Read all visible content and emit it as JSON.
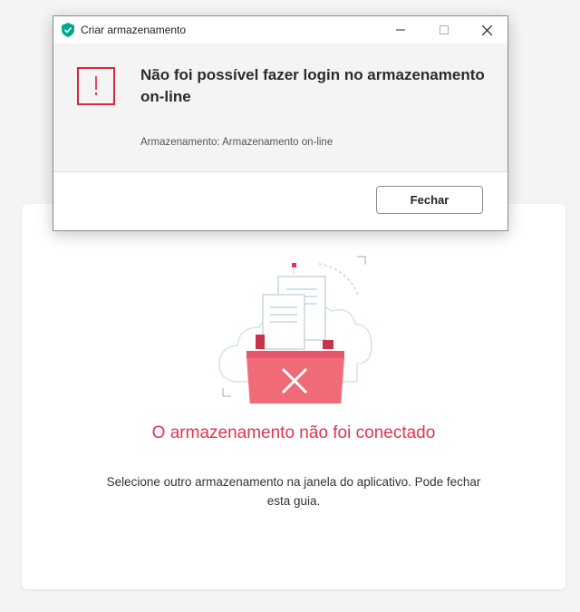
{
  "dialog": {
    "title": "Criar armazenamento",
    "headline": "Não foi possível fazer login no armazenamento on-line",
    "storage_info": "Armazenamento: Armazenamento on-line",
    "close_button": "Fechar",
    "error_glyph": "!",
    "icons": [
      "shield-check-icon",
      "minimize-icon",
      "maximize-icon",
      "close-icon",
      "error-icon"
    ]
  },
  "card": {
    "title": "O armazenamento não foi conectado",
    "message": "Selecione outro armazenamento na janela do aplicativo. Pode fechar esta guia.",
    "illustration": "folder-error-icon"
  },
  "colors": {
    "accent_red": "#e2334f",
    "error_border": "#d7263d",
    "brand_green": "#00a88e",
    "folder_red": "#f06b78"
  }
}
